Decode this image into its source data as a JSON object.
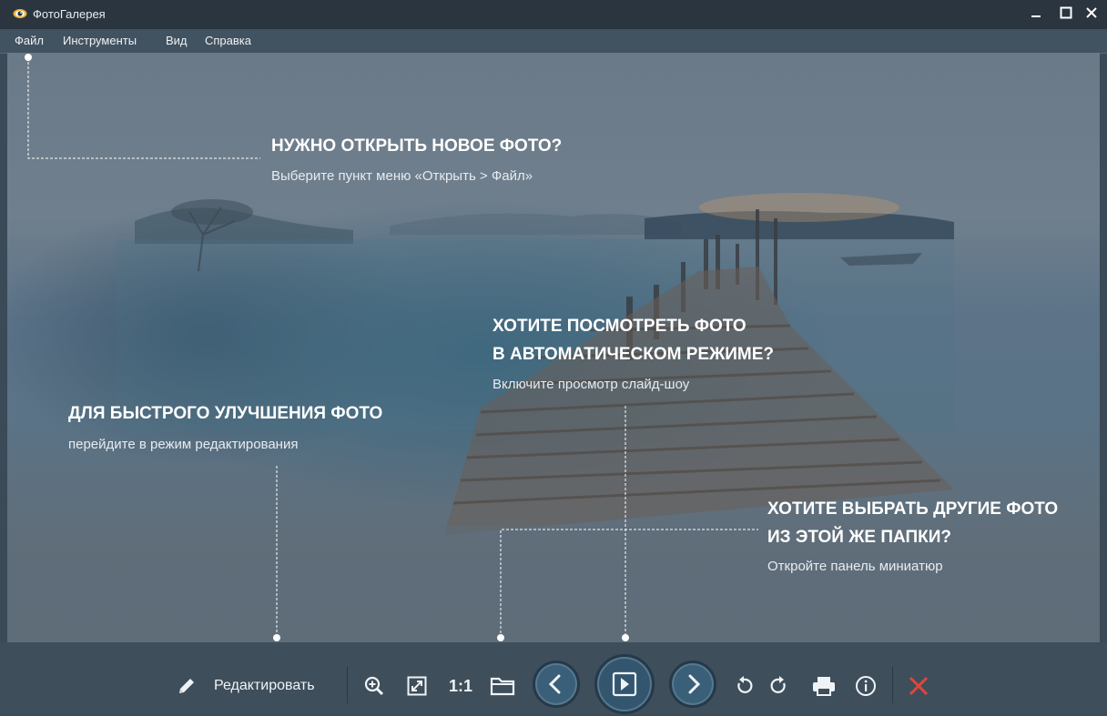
{
  "window": {
    "title": "ФотоГалерея",
    "controls": {
      "minimize": "–",
      "maximize": "□",
      "close": "×"
    }
  },
  "menu": [
    "Файл",
    "Инструменты",
    "Вид",
    "Справка"
  ],
  "hints": {
    "open": {
      "title": "НУЖНО ОТКРЫТЬ НОВОЕ ФОТО?",
      "subtitle": "Выберите пункт меню «Открыть > Файл»"
    },
    "slideshow": {
      "title": "ХОТИТЕ ПОСМОТРЕТЬ ФОТО\nВ АВТОМАТИЧЕСКОМ РЕЖИМЕ?",
      "subtitle": "Включите просмотр слайд-шоу"
    },
    "enhance": {
      "title": "ДЛЯ БЫСТРОГО УЛУЧШЕНИЯ ФОТО",
      "subtitle": "перейдите в режим редактирования"
    },
    "folder": {
      "title": "ХОТИТЕ ВЫБРАТЬ ДРУГИЕ ФОТО\nИЗ ЭТОЙ ЖЕ ПАПКИ?",
      "subtitle": "Откройте панель миниатюр"
    }
  },
  "toolbar": {
    "edit_label": "Редактировать",
    "actual_size_label": "1:1",
    "icons": [
      "pencil-icon",
      "zoom-in-icon",
      "fit-screen-icon",
      "folder-icon",
      "chevron-left-icon",
      "play-icon",
      "chevron-right-icon",
      "rotate-left-icon",
      "rotate-right-icon",
      "print-icon",
      "info-icon",
      "close-icon"
    ]
  },
  "colors": {
    "titlebar": "#2a3540",
    "menubar": "#415260",
    "toolbar": "#3e4e5b",
    "accent_red": "#e0463c",
    "nav_button": "#3a5f78"
  }
}
